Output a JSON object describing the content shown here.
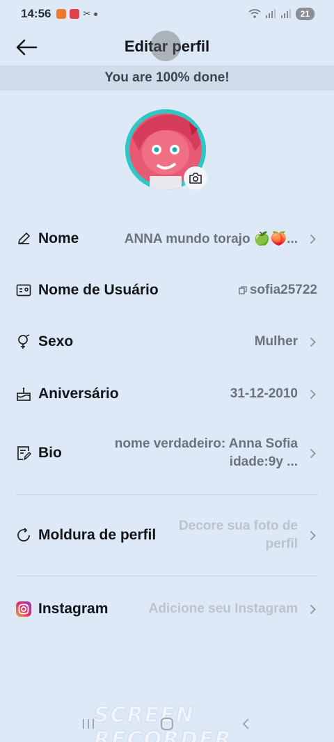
{
  "status_bar": {
    "time": "14:56",
    "battery": "21"
  },
  "header": {
    "title": "Editar perfil"
  },
  "progress": {
    "text": "You are 100% done!",
    "percent": 100
  },
  "rows": [
    {
      "key": "nome",
      "label": "Nome",
      "value": "ANNA mundo torajo 🍏🍑...",
      "icon": "pencil-icon"
    },
    {
      "key": "usuario",
      "label": "Nome de Usuário",
      "value": "sofia25722",
      "icon": "id-card-icon"
    },
    {
      "key": "sexo",
      "label": "Sexo",
      "value": "Mulher",
      "icon": "gender-icon"
    },
    {
      "key": "aniversario",
      "label": "Aniversário",
      "value": "31-12-2010",
      "icon": "cake-icon"
    },
    {
      "key": "bio",
      "label": "Bio",
      "value_line1": "nome verdadeiro: Anna Sofia",
      "value_line2": "idade:9y ...",
      "icon": "bio-edit-icon"
    },
    {
      "key": "moldura",
      "label": "Moldura de perfil",
      "value_line1": "Decore sua foto de",
      "value_line2": "perfil",
      "icon": "frame-icon"
    },
    {
      "key": "instagram",
      "label": "Instagram",
      "value": "Adicione seu Instagram",
      "icon": "instagram-icon"
    }
  ],
  "watermark": "SCREEN RECORDER",
  "colors": {
    "background": "#dde9f6",
    "banner": "#cfdcea",
    "value_text": "#6b737e",
    "placeholder_text": "#bcc3cc",
    "instagram": "#e1306c"
  }
}
